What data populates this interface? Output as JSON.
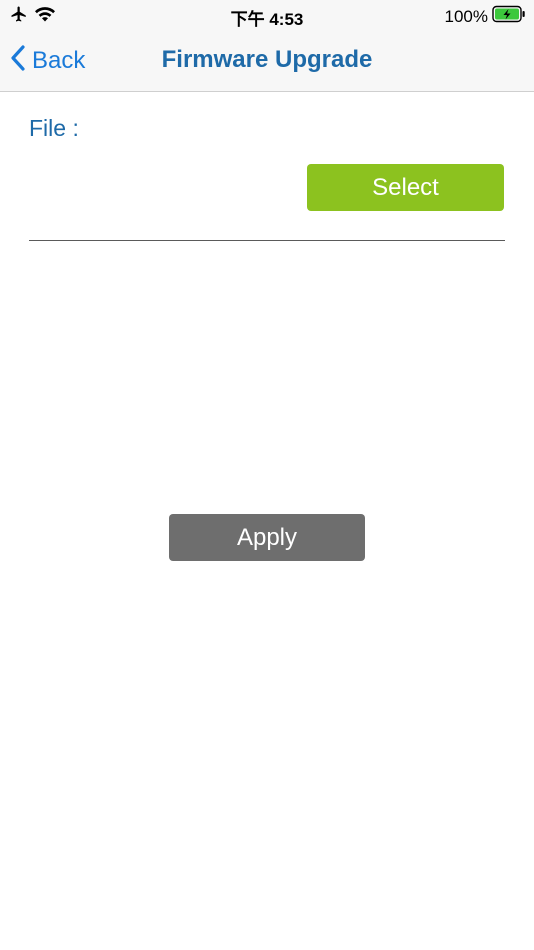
{
  "status_bar": {
    "time": "下午 4:53",
    "battery_percent": "100%",
    "icons": [
      "airplane-icon",
      "wifi-icon",
      "battery-charging-icon"
    ]
  },
  "nav": {
    "back_label": "Back",
    "title": "Firmware Upgrade"
  },
  "form": {
    "file_label": "File :",
    "file_value": "",
    "select_label": "Select",
    "apply_label": "Apply"
  },
  "colors": {
    "accent_blue": "#1a7ad9",
    "title_blue": "#1e6aa8",
    "select_green": "#8cc21f",
    "apply_gray": "#6e6e6e",
    "battery_green": "#3cc83c"
  }
}
